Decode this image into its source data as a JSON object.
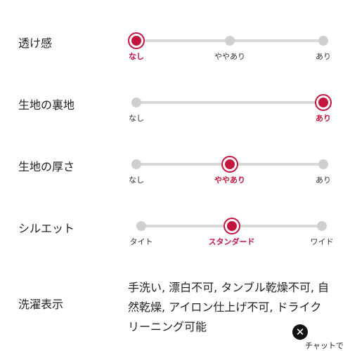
{
  "attributes": [
    {
      "label": "透け感",
      "stops": [
        "なし",
        "ややあり",
        "あり"
      ],
      "selected_index": 0
    },
    {
      "label": "生地の裏地",
      "stops": [
        "なし",
        "あり"
      ],
      "selected_index": 1
    },
    {
      "label": "生地の厚さ",
      "stops": [
        "なし",
        "ややあり",
        "あり"
      ],
      "selected_index": 1
    },
    {
      "label": "シルエット",
      "stops": [
        "タイト",
        "スタンダード",
        "ワイド"
      ],
      "selected_index": 1
    }
  ],
  "care": {
    "label": "洗濯表示",
    "text": "手洗い, 漂白不可, タンブル乾燥不可, 自然乾燥, アイロン仕上げ不可, ドライクリーニング可能"
  },
  "chat": {
    "close_icon": "close-icon",
    "close_glyph": "✕",
    "label": "チャットで"
  },
  "colors": {
    "accent": "#c3163e",
    "track": "#d8d8d8",
    "inactive_dot": "#cfcfcf"
  }
}
